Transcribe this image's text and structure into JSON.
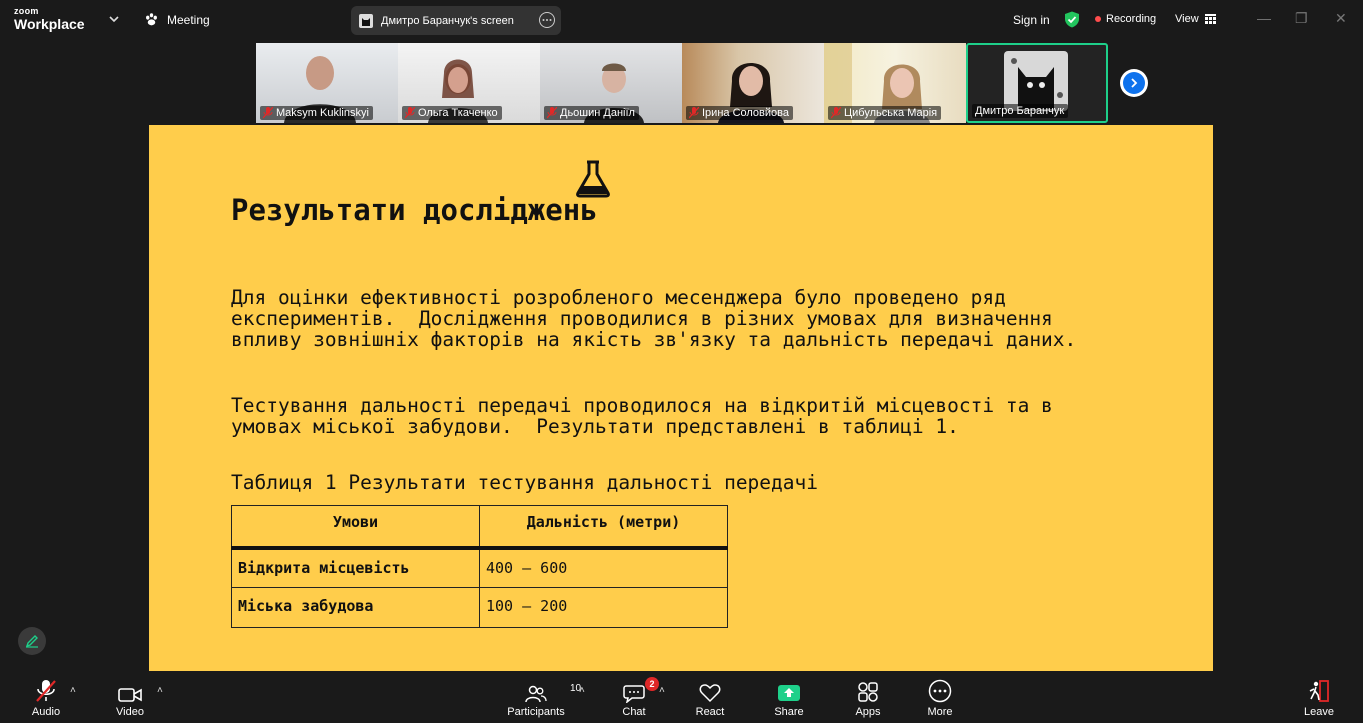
{
  "app": {
    "brand_small": "zoom",
    "brand_large": "Workplace"
  },
  "topbar": {
    "meeting_label": "Meeting",
    "screen_share_label": "Дмитро Баранчук's screen",
    "sign_in": "Sign in",
    "recording": "Recording",
    "view": "View"
  },
  "participants": [
    {
      "name": "Maksym Kuklinskyi",
      "muted": true
    },
    {
      "name": "Ольга Ткаченко",
      "muted": true
    },
    {
      "name": "Дьошин Даніїл",
      "muted": true
    },
    {
      "name": "Ірина Соловйова",
      "muted": true
    },
    {
      "name": "Цибульська Марія",
      "muted": true
    },
    {
      "name": "Дмитро Баранчук",
      "muted": false,
      "active": true
    }
  ],
  "slide": {
    "title": "Результати досліджень",
    "paragraph1": "Для оцінки ефективності розробленого месенджера було проведено ряд\nекспериментів.  Дослідження проводилися в різних умовах для визначення\nвпливу зовнішніх факторів на якість зв'язку та дальність передачі даних.",
    "paragraph2": "Тестування дальності передачі проводилося на відкритій місцевості та в\nумовах міської забудови.  Результати представлені в таблиці 1.",
    "table_caption": "Таблиця 1 Результати тестування дальності передачі",
    "table": {
      "headers": [
        "Умови",
        "Дальність (метри)"
      ],
      "rows": [
        [
          "Відкрита місцевість",
          "400 – 600"
        ],
        [
          "Міська забудова",
          "100 – 200"
        ]
      ]
    }
  },
  "toolbar": {
    "audio": "Audio",
    "video": "Video",
    "participants": "Participants",
    "participants_count": "10",
    "chat": "Chat",
    "chat_badge": "2",
    "react": "React",
    "share": "Share",
    "apps": "Apps",
    "more": "More",
    "leave": "Leave"
  },
  "colors": {
    "slide_bg": "#ffcd4b",
    "share_green": "#1ed08a",
    "accent_blue": "#0e72ed",
    "recording_red": "#ff4d4d"
  }
}
